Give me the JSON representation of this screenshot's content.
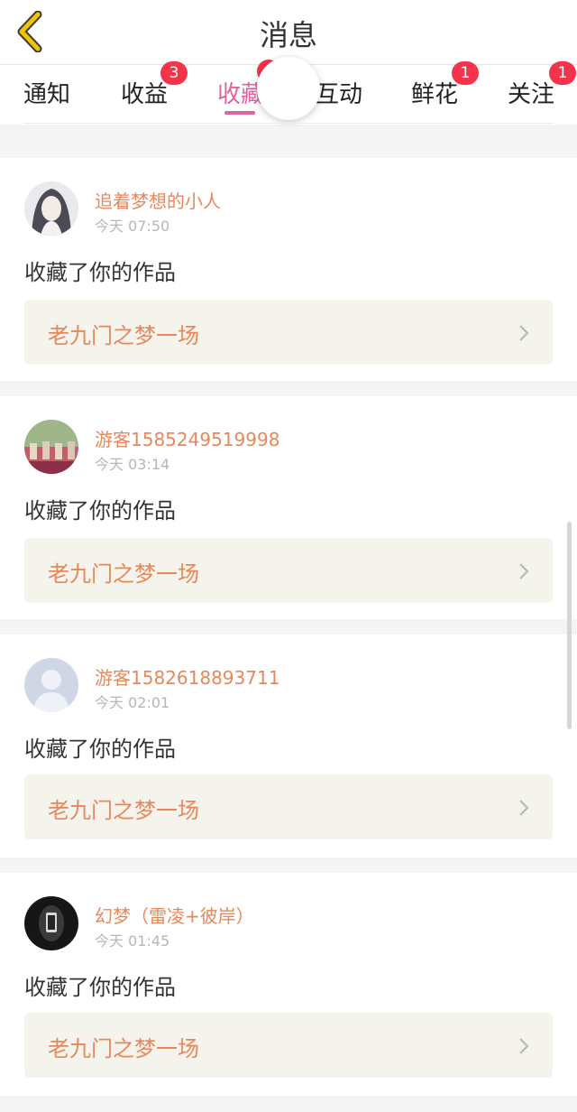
{
  "header": {
    "title": "消息",
    "back_icon": "chevron-left-icon",
    "accent": "#f2c300"
  },
  "tabs": [
    {
      "label": "通知",
      "badge": ""
    },
    {
      "label": "收益",
      "badge": "3"
    },
    {
      "label": "收藏",
      "badge": ""
    },
    {
      "label": "互动",
      "badge": ""
    },
    {
      "label": "鲜花",
      "badge": "1"
    },
    {
      "label": "关注",
      "badge": "1"
    }
  ],
  "active_tab_color": "#e0649b",
  "messages": [
    {
      "user": "追着梦想的小人",
      "time": "今天 07:50",
      "action": "收藏了你的作品",
      "work": "老九门之梦一场"
    },
    {
      "user": "游客1585249519998",
      "time": "今天 03:14",
      "action": "收藏了你的作品",
      "work": "老九门之梦一场"
    },
    {
      "user": "游客1582618893711",
      "time": "今天 02:01",
      "action": "收藏了你的作品",
      "work": "老九门之梦一场"
    },
    {
      "user": "幻梦（雷凌+彼岸）",
      "time": "今天 01:45",
      "action": "收藏了你的作品",
      "work": "老九门之梦一场"
    }
  ]
}
